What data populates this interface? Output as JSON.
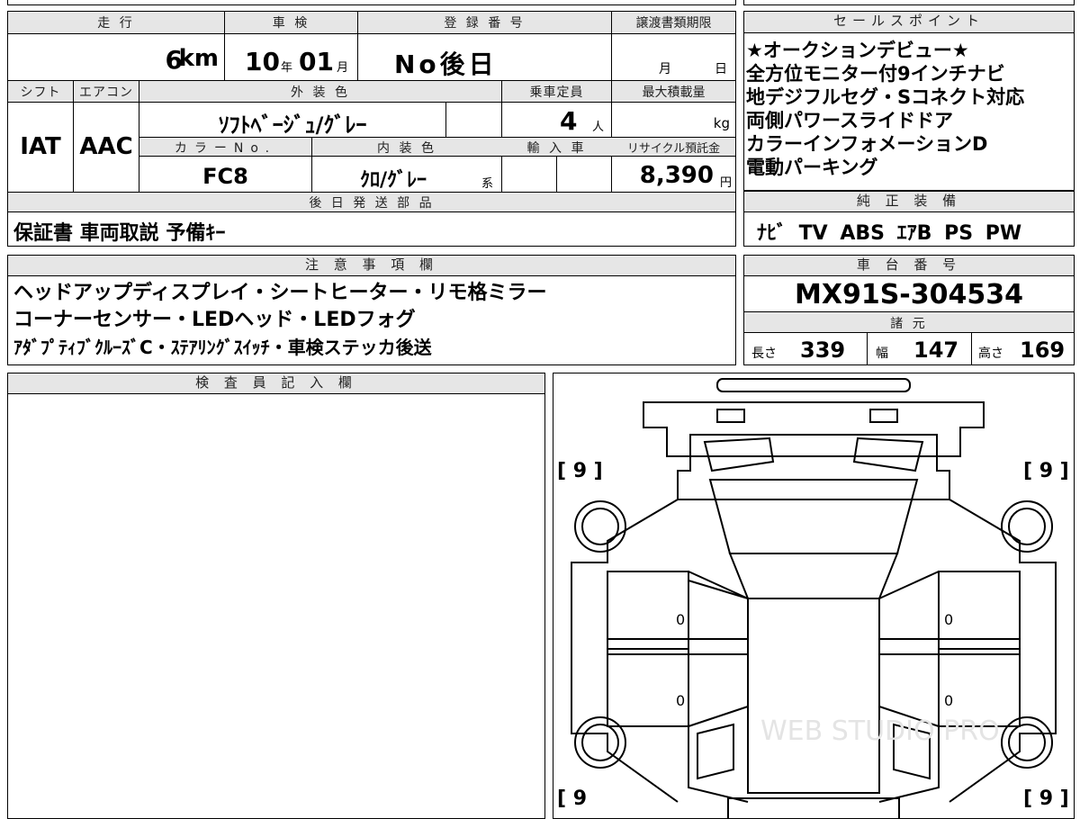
{
  "top_sheet": {
    "mileage_label": "走 行",
    "mileage_value": "6",
    "mileage_unit": "km",
    "inspection_label": "車 検",
    "inspection_year": "10",
    "inspection_year_unit": "年",
    "inspection_month": "01",
    "inspection_month_unit": "月",
    "registration_label": "登 録 番 号",
    "registration_value": "No後日",
    "transfer_label": "譲渡書類期限",
    "transfer_month": "月",
    "transfer_day": "日",
    "shift_label": "シフト",
    "shift_value": "IAT",
    "ac_label": "エアコン",
    "ac_value": "AAC",
    "exterior_label": "外 装 色",
    "exterior_value": "ｿﾌﾄﾍﾞｰｼﾞｭ/ｸﾞﾚｰ",
    "capacity_label": "乗車定員",
    "capacity_value": "4",
    "capacity_unit": "人",
    "maxload_label": "最大積載量",
    "maxload_unit": "kg",
    "color_no_label": "カラーNo.",
    "color_no_value": "FC8",
    "interior_label": "内 装 色",
    "interior_value": "ｸﾛ/ｸﾞﾚｰ",
    "interior_suffix": "系",
    "import_label": "輸 入 車",
    "recycle_label": "リサイクル預託金",
    "recycle_value": "8,390",
    "recycle_unit": "円",
    "later_parts_label": "後 日 発 送 部 品",
    "later_parts_value": "保証書 車両取説 予備ｷｰ"
  },
  "sales_points": {
    "label": "セールスポイント",
    "lines": [
      "★オークションデビュー★",
      "全方位モニター付9インチナビ",
      "地デジフルセグ・Sコネクト対応",
      "両側パワースライドドア",
      "カラーインフォメーションD",
      "電動パーキング"
    ]
  },
  "genuine_equipment": {
    "label": "純 正 装 備",
    "value": "ﾅﾋﾞ TV ABS ｴｱB PS PW"
  },
  "notes": {
    "label": "注 意 事 項 欄",
    "lines": [
      "ヘッドアップディスプレイ・シートヒーター・リモ格ミラー",
      "コーナーセンサー・LEDヘッド・LEDフォグ",
      "ｱﾀﾞﾌﾟﾃｨﾌﾞｸﾙｰｽﾞC・ｽﾃｱﾘﾝｸﾞｽｲｯﾁ・車検ステッカ後送"
    ]
  },
  "chassis": {
    "label": "車 台 番 号",
    "value": "MX91S-304534",
    "specs_label": "諸 元",
    "length_label": "長さ",
    "length_value": "339",
    "width_label": "幅",
    "width_value": "147",
    "height_label": "高さ",
    "height_value": "169"
  },
  "inspector": {
    "label": "検 査 員 記 入 欄"
  },
  "diagram": {
    "tire_front_left": "[ 9 ]",
    "tire_front_right": "[ 9 ]",
    "tire_rear_left": "[ 9",
    "tire_rear_right": "[ 9 ]",
    "door_front_left": "0",
    "door_rear_left": "0",
    "door_front_right": "0",
    "door_rear_right": "0",
    "watermark": "WEB STUDIO PRO"
  }
}
